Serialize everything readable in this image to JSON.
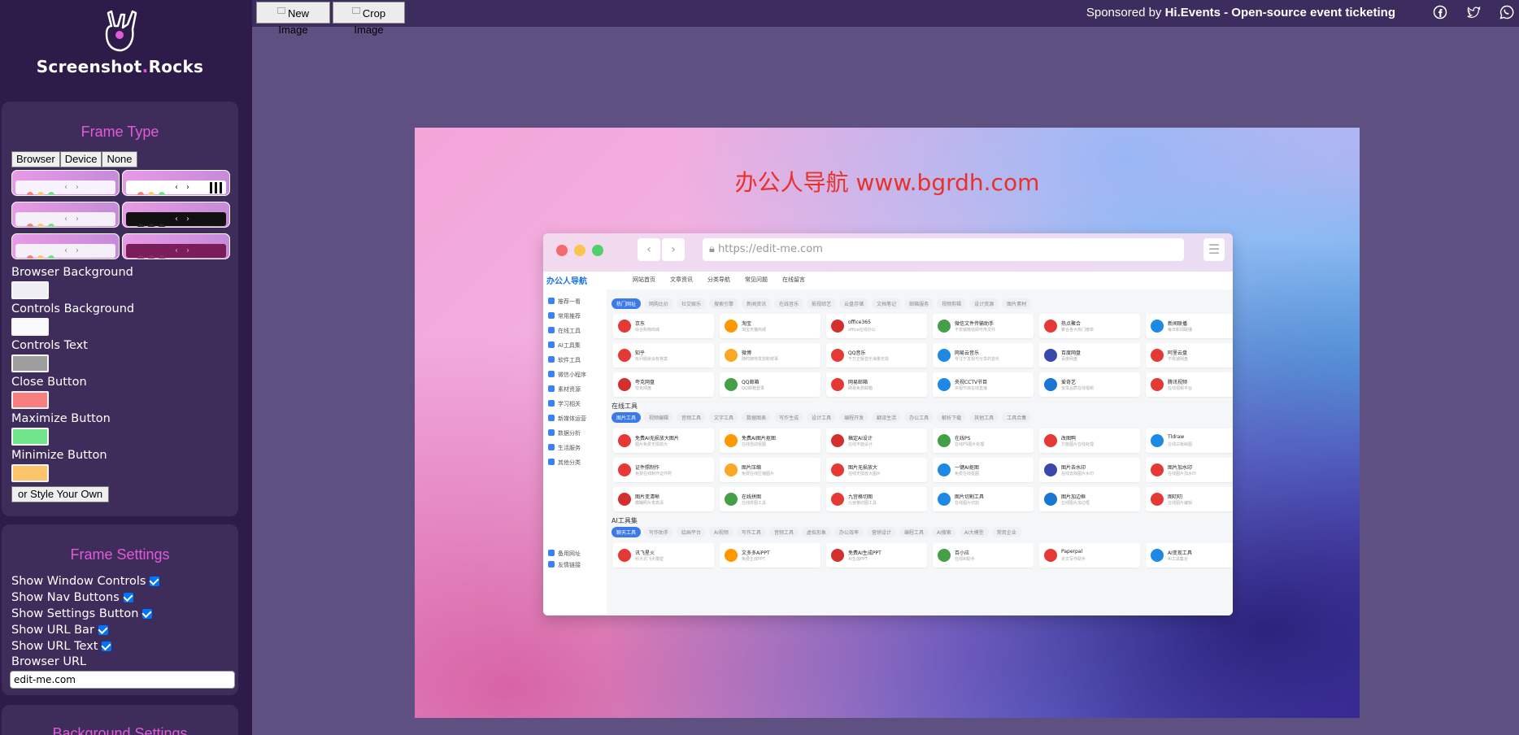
{
  "app": {
    "logo_text_main": "Screenshot",
    "logo_text_dot": ".",
    "logo_text_end": "Rocks"
  },
  "toolbar": {
    "new_image": "New Image",
    "crop_image": "Crop Image",
    "sponsor_prefix": "Sponsored by ",
    "sponsor_name": "Hi.Events",
    "sponsor_suffix": " - Open-source event ticketing",
    "social_icons": [
      "facebook-icon",
      "twitter-icon",
      "whatsapp-icon"
    ]
  },
  "frame_type": {
    "title": "Frame Type",
    "tabs": [
      "Browser",
      "Device",
      "None"
    ],
    "presets": [
      {
        "bar": "#f7f2fb",
        "dots": [
          "#f08080",
          "#f8c870",
          "#78dd88"
        ],
        "nav": "#888"
      },
      {
        "bar": "#ffffff",
        "dots": [
          "#f08080",
          "#f8c870",
          "#78dd88"
        ],
        "nav": "#111",
        "dark_strip": true
      },
      {
        "bar": "#f4eff9",
        "dots": [
          "#f08080",
          "#f8c870",
          "#78dd88"
        ],
        "nav": "#888"
      },
      {
        "bar": "#111111",
        "dots": [
          "#222222",
          "#222222",
          "#222222"
        ],
        "nav": "#ddd"
      },
      {
        "bar": "#f4eff9",
        "dots": [
          "#f08080",
          "#f8c870",
          "#78dd88"
        ],
        "nav": "#888"
      },
      {
        "bar": "#7a1d5a",
        "dots": [
          "#8a2d6a",
          "#8a2d6a",
          "#8a2d6a"
        ],
        "nav": "#bbb"
      }
    ],
    "browser_background_label": "Browser Background",
    "browser_background_color": "#f0eef5",
    "controls_background_label": "Controls Background",
    "controls_background_color": "#fafafa",
    "controls_text_label": "Controls Text",
    "controls_text_color": "#9e9e9e",
    "close_button_label": "Close Button",
    "close_button_color": "#f67e7e",
    "maximize_button_label": "Maximize Button",
    "maximize_button_color": "#70e48a",
    "minimize_button_label": "Minimize Button",
    "minimize_button_color": "#fdc56b",
    "style_own": "or Style Your Own"
  },
  "frame_settings": {
    "title": "Frame Settings",
    "show_window_controls": "Show Window Controls",
    "show_nav_buttons": "Show Nav Buttons",
    "show_settings_button": "Show Settings Button",
    "show_url_bar": "Show URL Bar",
    "show_url_text": "Show URL Text",
    "browser_url_label": "Browser URL",
    "browser_url_value": "edit-me.com"
  },
  "background_settings": {
    "title": "Background Settings"
  },
  "canvas": {
    "watermark": "办公人导航 www.bgrdh.com",
    "browser": {
      "url": "https://edit-me.com",
      "dot_colors": [
        "#f56b6b",
        "#fbc34f",
        "#4fd068"
      ],
      "site": {
        "logo": "办公人导航",
        "nav": [
          "网站首页",
          "文章资讯",
          "分类导航",
          "常见问题",
          "在线留言"
        ],
        "side": [
          "推荐一看",
          "常用推荐",
          "在线工具",
          "AI工具集",
          "软件工具",
          "微信小程序",
          "素材资源",
          "学习相关",
          "新媒体运营",
          "数据分析",
          "生活服务",
          "其他分类",
          "备用网址",
          "友情链接"
        ],
        "tabs_1": [
          "热门网址",
          "网购比价",
          "社交娱乐",
          "搜索引擎",
          "新闻资讯",
          "在线音乐",
          "影视综艺",
          "云盘存储",
          "文档笔记",
          "邮箱服务",
          "视频剪辑",
          "设计资源",
          "图片素材"
        ],
        "section_2": "在线工具",
        "tabs_2": [
          "图片工具",
          "视频编辑",
          "音频工具",
          "文字工具",
          "数据图表",
          "写作生成",
          "设计工具",
          "编程开发",
          "翻译生活",
          "办公工具",
          "解析下载",
          "其他工具",
          "工具合集"
        ],
        "section_3": "AI工具集",
        "tabs_3": [
          "聊天工具",
          "写作助手",
          "绘画平台",
          "AI视频",
          "写作工具",
          "音频工具",
          "虚拟形象",
          "办公效率",
          "营销设计",
          "编程工具",
          "AI搜索",
          "AI大模型",
          "常用企业"
        ],
        "cards_1": [
          [
            "京东",
            "综合购物商城"
          ],
          [
            "淘宝",
            "淘宝天猫商城"
          ],
          [
            "office365",
            "office在线办公"
          ],
          [
            "微信文件传输助手",
            "不安装微信即可传文件"
          ],
          [
            "热点聚合",
            "聚合各大热门榜单"
          ],
          [
            "新闻联播",
            "每日新闻联播"
          ],
          [
            "知乎",
            "有问题就会有答案"
          ],
          [
            "微博",
            "随时随地发现新鲜事"
          ],
          [
            "QQ音乐",
            "千万正版音乐海量无损"
          ],
          [
            "网易云音乐",
            "专注于发现与分享的音乐"
          ],
          [
            "百度网盘",
            "百度网盘"
          ],
          [
            "阿里云盘",
            "不限速网盘"
          ],
          [
            "夸克网盘",
            "夸克网盘"
          ],
          [
            "QQ邮箱",
            "QQ邮箱登录"
          ],
          [
            "网易邮箱",
            "网易免费邮箱"
          ],
          [
            "央视CCTV节目",
            "央视节目在线直播"
          ],
          [
            "爱奇艺",
            "悦享品质在线视频"
          ],
          [
            "腾讯视频",
            "在线视频平台"
          ]
        ],
        "cards_2": [
          [
            "免费AI无损放大图片",
            "图片免费无损放大"
          ],
          [
            "免费AI图片抠图",
            "在线自动抠图"
          ],
          [
            "稿定AI设计",
            "在线平面设计"
          ],
          [
            "在线PS",
            "在线PS图片处理"
          ],
          [
            "改图鸭",
            "万能图片在线处理"
          ],
          [
            "Tldraw",
            "在线白板绘图"
          ],
          [
            "证件照制作",
            "免费在线制作证件照"
          ],
          [
            "图片压缩",
            "免费在线压缩图片"
          ],
          [
            "图片无损放大",
            "在线无损放大图片"
          ],
          [
            "一键AI抠图",
            "免费在线抠图"
          ],
          [
            "图片去水印",
            "在线去除图片水印"
          ],
          [
            "图片加水印",
            "在线图片加水印"
          ],
          [
            "图片变清晰",
            "模糊照片变高清"
          ],
          [
            "在线拼图",
            "在线拼图工具"
          ],
          [
            "九宫格切图",
            "九宫格切图工具"
          ],
          [
            "图片切割工具",
            "在线图片切割"
          ],
          [
            "图片加边框",
            "在线图片加边框"
          ],
          [
            "图叨叨",
            "在线图片编辑"
          ]
        ],
        "cards_3": [
          [
            "讯飞星火",
            "科大讯飞大模型"
          ],
          [
            "文多多AiPPT",
            "免费生成PPT"
          ],
          [
            "免费AI生成PPT",
            "AI生成PPT"
          ],
          [
            "百小应",
            "在线AI助手"
          ],
          [
            "Paperpal",
            "论文写作助手"
          ],
          [
            "AI变现工具",
            "AI工具集合"
          ]
        ]
      }
    }
  }
}
